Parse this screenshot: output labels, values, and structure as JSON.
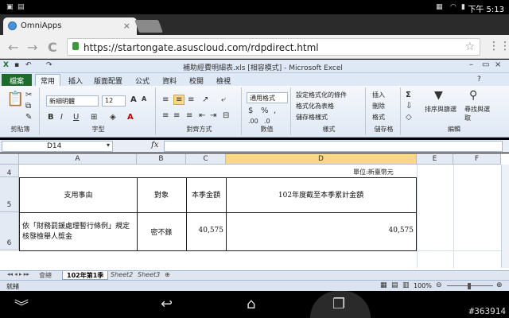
{
  "status_bar": {
    "time": "下午 5:13"
  },
  "browser": {
    "tab_title": "OmniApps",
    "tab_close": "×",
    "url": "https://startongate.asuscloud.com/rdpdirect.html",
    "back": "←",
    "forward": "→",
    "reload": "C"
  },
  "excel": {
    "window_title": "補助經費明細表.xls [相容模式] - Microsoft Excel",
    "ribbon_tabs": [
      "檔案",
      "常用",
      "插入",
      "版面配置",
      "公式",
      "資料",
      "校閱",
      "檢視"
    ],
    "active_tab": "常用",
    "font_name": "新細明體",
    "font_size": "12",
    "number_format": "通用格式",
    "groups": {
      "clipboard": "剪貼簿",
      "font": "字型",
      "alignment": "對齊方式",
      "number": "數值",
      "styles": "樣式",
      "cells": "儲存格",
      "editing": "編輯"
    },
    "styles_items": [
      "設定格式化的條件",
      "格式化為表格",
      "儲存格樣式"
    ],
    "cells_items": [
      "插入",
      "刪除",
      "格式"
    ],
    "editing_items": [
      "排序與篩選",
      "尋找與選取"
    ],
    "name_box": "D14",
    "fx": "fx",
    "columns": [
      "A",
      "B",
      "C",
      "D",
      "E",
      "F"
    ],
    "selected_column": "D",
    "rows": [
      "4",
      "5",
      "6"
    ],
    "unit_label": "單位:新臺幣元",
    "table": {
      "headers": [
        "支用事由",
        "對象",
        "本季金額",
        "102年度截至本季累計金額"
      ],
      "row": {
        "reason": "依「財務罰鍰處理暫行條例」規定核發檢舉人獎金",
        "target": "密不錄",
        "quarter_amount": "40,575",
        "cumulative_amount": "40,575"
      }
    },
    "sheet_tabs": [
      "會總",
      "102年第1季",
      "Sheet2",
      "Sheet3"
    ],
    "active_sheet": "102年第1季",
    "status": "就緒",
    "zoom": "100%"
  },
  "watermark": "#363914"
}
